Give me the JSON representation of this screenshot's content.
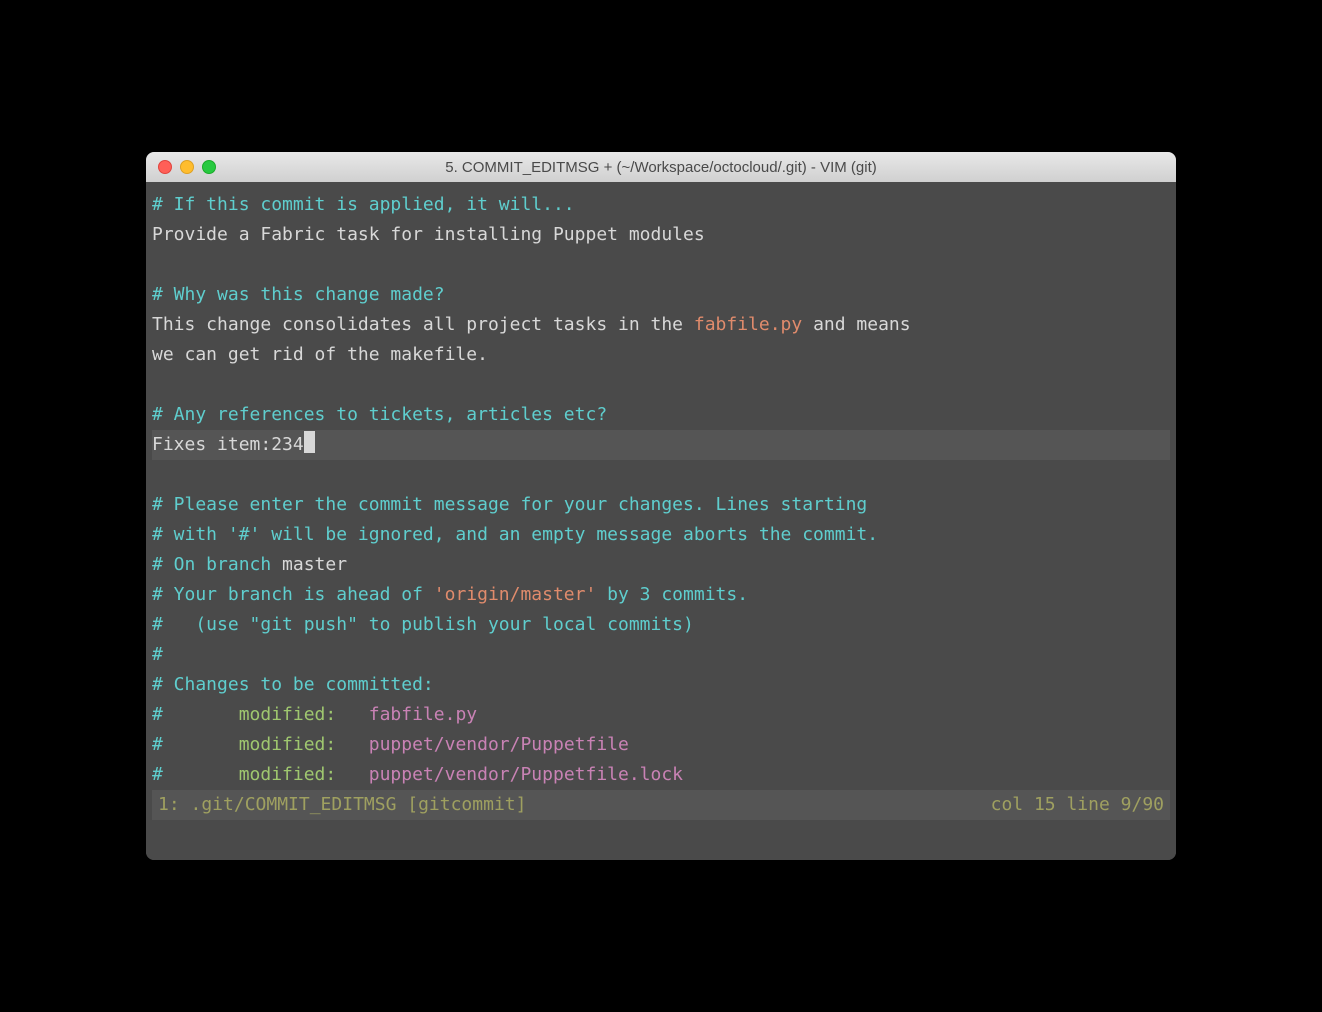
{
  "window": {
    "title": "5. COMMIT_EDITMSG + (~/Workspace/octocloud/.git) - VIM (git)"
  },
  "content": {
    "comment1": "# If this commit is applied, it will...",
    "line1": "Provide a Fabric task for installing Puppet modules",
    "comment2": "# Why was this change made?",
    "line2a": "This change consolidates all project tasks in the ",
    "line2_file": "fabfile.py",
    "line2b": " and means",
    "line3": "we can get rid of the makefile.",
    "comment3": "# Any references to tickets, articles etc?",
    "line4": "Fixes item:234",
    "comment4": "# Please enter the commit message for your changes. Lines starting",
    "comment5": "# with '#' will be ignored, and an empty message aborts the commit.",
    "comment6a": "# On branch ",
    "branch": "master",
    "comment7a": "# Your branch is ahead of ",
    "remote": "'origin/master'",
    "comment7b": " by 3 commits.",
    "comment8": "#   (use \"git push\" to publish your local commits)",
    "comment9": "#",
    "comment10": "# Changes to be committed:",
    "hash": "#",
    "mod_label": "modified:   ",
    "mod_file1": "fabfile.py",
    "mod_file2": "puppet/vendor/Puppetfile",
    "mod_file3": "puppet/vendor/Puppetfile.lock"
  },
  "statusbar": {
    "left": "1: .git/COMMIT_EDITMSG [gitcommit]",
    "right": "col 15 line 9/90"
  }
}
